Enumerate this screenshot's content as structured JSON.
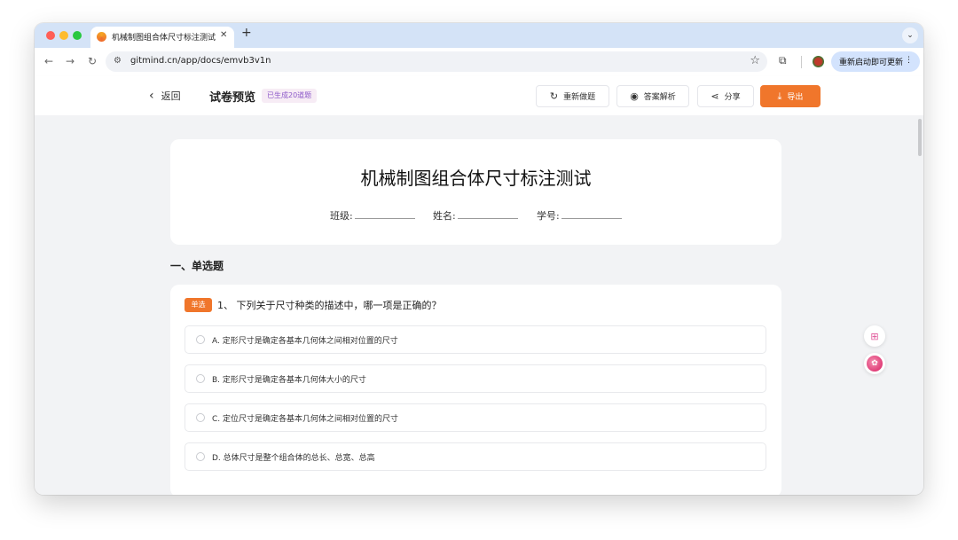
{
  "browser": {
    "tab_title": "机械制图组合体尺寸标注测试",
    "new_tab_icon": "+",
    "url": "gitmind.cn/app/docs/emvb3v1n",
    "update_button_label": "重新启动即可更新"
  },
  "header": {
    "back_label": "返回",
    "page_title": "试卷预览",
    "badge": "已生成20道题",
    "buttons": {
      "redo": "重新做题",
      "answer": "答案解析",
      "share": "分享",
      "export": "导出"
    }
  },
  "exam": {
    "title": "机械制图组合体尺寸标注测试",
    "fields": {
      "class": "班级:",
      "name": "姓名:",
      "student_id": "学号:"
    }
  },
  "section": {
    "title": "一、单选题"
  },
  "question": {
    "type_badge": "单选",
    "text": "1、 下列关于尺寸种类的描述中，哪一项是正确的？",
    "options": [
      "A. 定形尺寸是确定各基本几何体之间相对位置的尺寸",
      "B. 定形尺寸是确定各基本几何体大小的尺寸",
      "C. 定位尺寸是确定各基本几何体之间相对位置的尺寸",
      "D. 总体尺寸是整个组合体的总长、总宽、总高"
    ]
  },
  "colors": {
    "accent": "#f0762b",
    "badge_text": "#8e5ac9",
    "tabstrip": "#d4e3f7"
  }
}
